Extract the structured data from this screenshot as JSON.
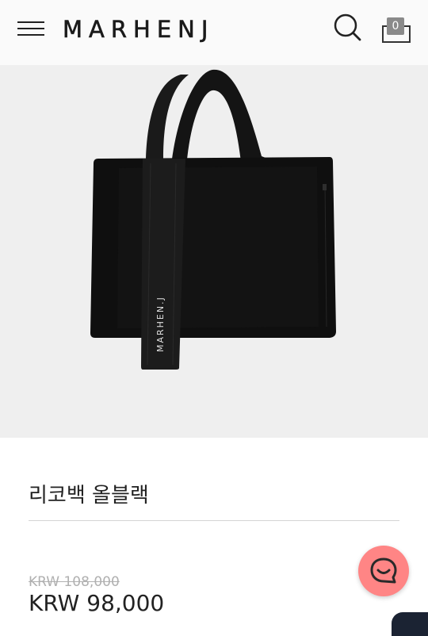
{
  "header": {
    "logo": "MARHENJ",
    "cart_count": "0"
  },
  "hero": {
    "strap_text": "MARHEN.J"
  },
  "product": {
    "title": "리코백 올블랙",
    "original_price": "KRW 108,000",
    "sale_price": "KRW 98,000"
  },
  "icons": {
    "menu": "hamburger-menu-icon",
    "search": "search-icon",
    "cart": "shopping-bag-icon",
    "chat": "chat-bubble-icon"
  },
  "colors": {
    "accent_chat": "#ff8585",
    "hero_background": "#efefef",
    "bag": "#101010"
  }
}
